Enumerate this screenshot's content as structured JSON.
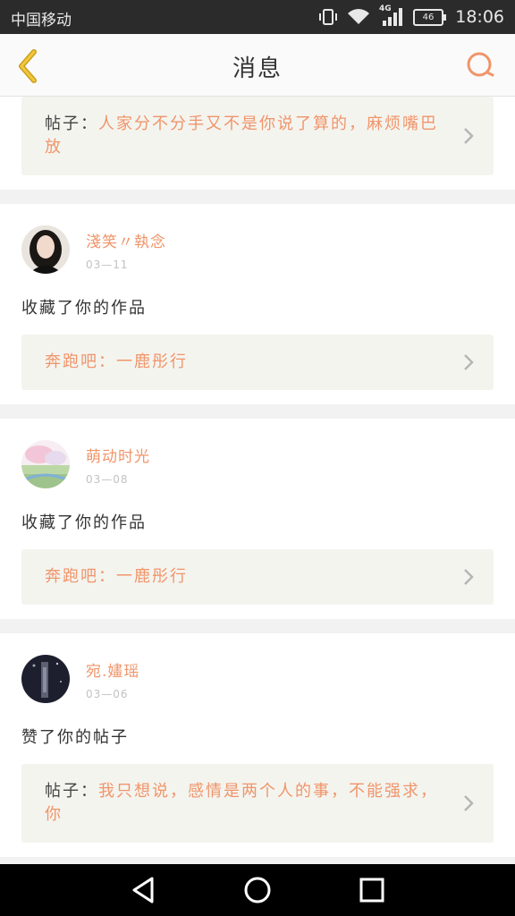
{
  "status": {
    "carrier": "中国移动",
    "network": "4G",
    "battery": "46",
    "time": "18:06"
  },
  "header": {
    "title": "消息"
  },
  "colors": {
    "accent": "#f0956a",
    "card_bg": "#ffffff",
    "quote_bg": "#f4f4ef"
  },
  "posts": [
    {
      "quote_label": "帖子：",
      "quote_text": "人家分不分手又不是你说了算的，麻烦嘴巴放"
    },
    {
      "username": "淺笑〃執念",
      "date": "03—11",
      "action": "收藏了你的作品",
      "quote_text": "奔跑吧：一鹿彤行"
    },
    {
      "username": "萌动时光",
      "date": "03—08",
      "action": "收藏了你的作品",
      "quote_text": "奔跑吧：一鹿彤行"
    },
    {
      "username": "宛.嫿瑶",
      "date": "03—06",
      "action": "赞了你的帖子",
      "quote_label": "帖子：",
      "quote_text": "我只想说，感情是两个人的事，不能强求，你"
    }
  ],
  "navbar": {
    "back": "back-nav-icon",
    "home": "home-nav-icon",
    "recents": "recents-nav-icon"
  }
}
